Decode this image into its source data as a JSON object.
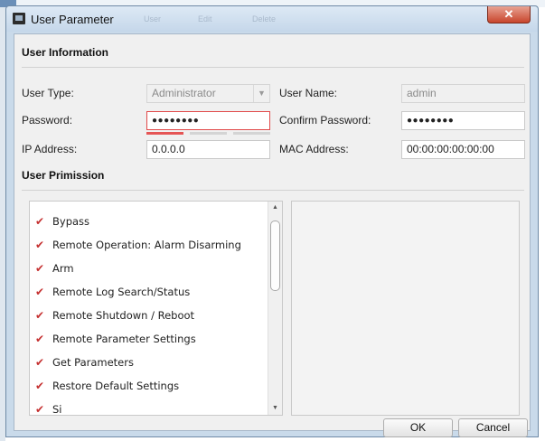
{
  "window": {
    "title": "User Parameter",
    "close_glyph": "✕",
    "toolbar_ghost": [
      "User",
      "Edit",
      "Delete"
    ]
  },
  "user_info": {
    "section_title": "User Information",
    "user_type_label": "User Type:",
    "user_type_value": "Administrator",
    "user_name_label": "User Name:",
    "user_name_value": "admin",
    "password_label": "Password:",
    "password_value": "●●●●●●●●",
    "confirm_password_label": "Confirm Password:",
    "confirm_password_value": "●●●●●●●●",
    "ip_label": "IP Address:",
    "ip_value": "0.0.0.0",
    "mac_label": "MAC Address:",
    "mac_value": "00:00:00:00:00:00",
    "password_strength_level": 1,
    "password_strength_segments": 3
  },
  "permissions": {
    "section_title": "User Primission",
    "items": [
      {
        "label": "Bypass",
        "checked": true
      },
      {
        "label": "Remote Operation: Alarm Disarming",
        "checked": true
      },
      {
        "label": "Arm",
        "checked": true
      },
      {
        "label": "Remote Log Search/Status",
        "checked": true
      },
      {
        "label": "Remote Shutdown / Reboot",
        "checked": true
      },
      {
        "label": "Remote Parameter Settings",
        "checked": true
      },
      {
        "label": "Get Parameters",
        "checked": true
      },
      {
        "label": "Restore Default Settings",
        "checked": true
      },
      {
        "label": "Si",
        "checked": true
      }
    ]
  },
  "buttons": {
    "ok": "OK",
    "cancel": "Cancel"
  },
  "icons": {
    "window_icon": "app-icon",
    "check": "checkmark-icon",
    "dropdown": "chevron-down-icon",
    "scroll_up": "scroll-up-arrow-icon",
    "scroll_down": "scroll-down-arrow-icon"
  },
  "colors": {
    "titlebar": "#c5d7ea",
    "close_button": "#c8452c",
    "active_field_border": "#e14a4a",
    "strength_weak": "#e55555",
    "checkmark": "#c53030"
  }
}
